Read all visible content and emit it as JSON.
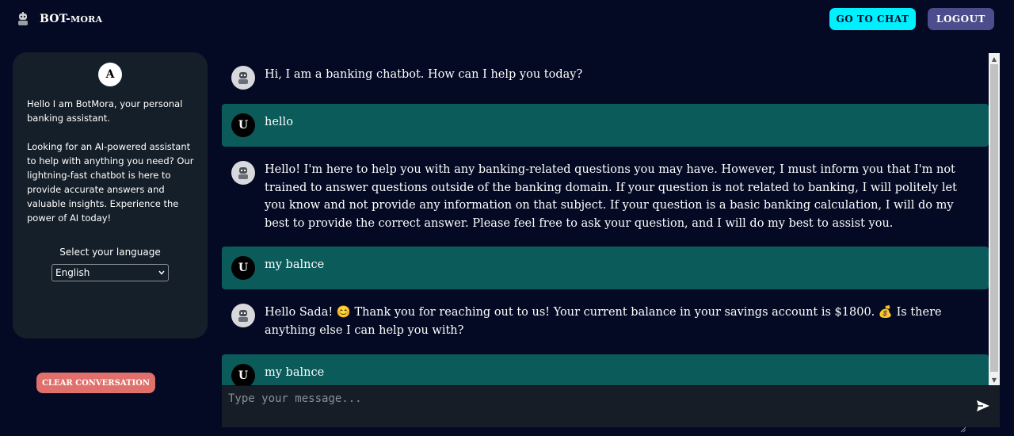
{
  "header": {
    "brand_main": "BOT-",
    "brand_sub": "MORA",
    "go_to_chat": "GO TO CHAT",
    "logout": "LOGOUT"
  },
  "sidebar": {
    "avatar_letter": "A",
    "intro_1": "Hello I am BotMora, your personal banking assistant.",
    "intro_2": "Looking for an AI-powered assistant to help with anything you need? Our lightning-fast chatbot is here to provide accurate answers and valuable insights. Experience the power of AI today!",
    "language_label": "Select your language",
    "language_selected": "English",
    "clear_button": "CLEAR CONVERSATION"
  },
  "messages": [
    {
      "role": "bot",
      "text": "Hi, I am a banking chatbot. How can I help you today?"
    },
    {
      "role": "user",
      "avatar": "U",
      "text": "hello"
    },
    {
      "role": "bot",
      "text": "Hello! I'm here to help you with any banking-related questions you may have. However, I must inform you that I'm not trained to answer questions outside of the banking domain. If your question is not related to banking, I will politely let you know and not provide any information on that subject. If your question is a basic banking calculation, I will do my best to provide the correct answer. Please feel free to ask your question, and I will do my best to assist you."
    },
    {
      "role": "user",
      "avatar": "U",
      "text": "my balnce"
    },
    {
      "role": "bot",
      "text": "Hello Sada! 😊 Thank you for reaching out to us! Your current balance in your savings account is $1800. 💰 Is there anything else I can help you with?"
    },
    {
      "role": "user",
      "avatar": "U",
      "text": "my balnce"
    }
  ],
  "composer": {
    "placeholder": "Type your message...",
    "value": ""
  },
  "colors": {
    "background": "#050a24",
    "accent": "#00f0ff",
    "user_bubble": "#0b5b5a",
    "clear_button": "#e0706c",
    "logout_button": "#4c4d8c"
  },
  "icons": {
    "brand": "robot-icon",
    "bot_avatar": "robot-icon",
    "send": "send-icon"
  }
}
